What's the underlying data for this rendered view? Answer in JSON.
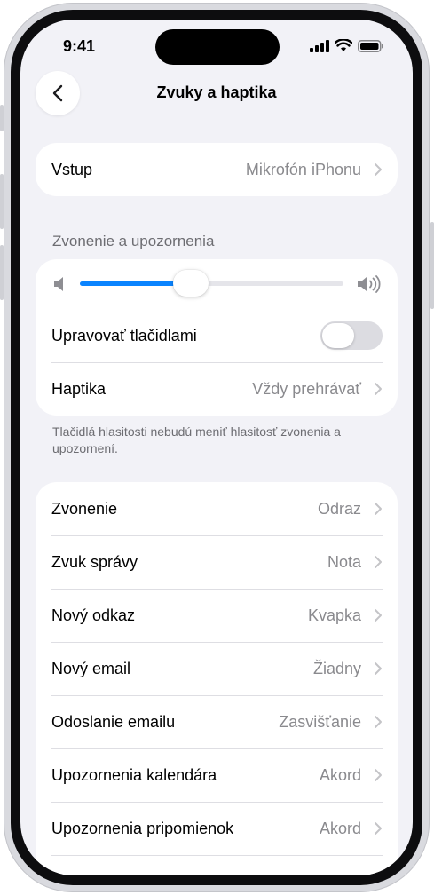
{
  "status_bar": {
    "time": "9:41"
  },
  "nav": {
    "title": "Zvuky a haptika",
    "back_icon": "chevron-left-icon"
  },
  "input_row": {
    "label": "Vstup",
    "value": "Mikrofón iPhonu"
  },
  "ringer_section": {
    "header": "Zvonenie a upozornenia",
    "volume_level": 0.42,
    "accent_color": "#0a84ff",
    "change_with_buttons": {
      "label": "Upravovať tlačidlami",
      "on": false
    },
    "haptics": {
      "label": "Haptika",
      "value": "Vždy prehrávať"
    },
    "footnote": "Tlačidlá hlasitosti nebudú meniť hlasitosť zvonenia a upozornení."
  },
  "sounds": [
    {
      "label": "Zvonenie",
      "value": "Odraz"
    },
    {
      "label": "Zvuk správy",
      "value": "Nota"
    },
    {
      "label": "Nový odkaz",
      "value": "Kvapka"
    },
    {
      "label": "Nový email",
      "value": "Žiadny"
    },
    {
      "label": "Odoslanie emailu",
      "value": "Zasvišťanie"
    },
    {
      "label": "Upozornenia kalendára",
      "value": "Akord"
    },
    {
      "label": "Upozornenia pripomienok",
      "value": "Akord"
    }
  ]
}
